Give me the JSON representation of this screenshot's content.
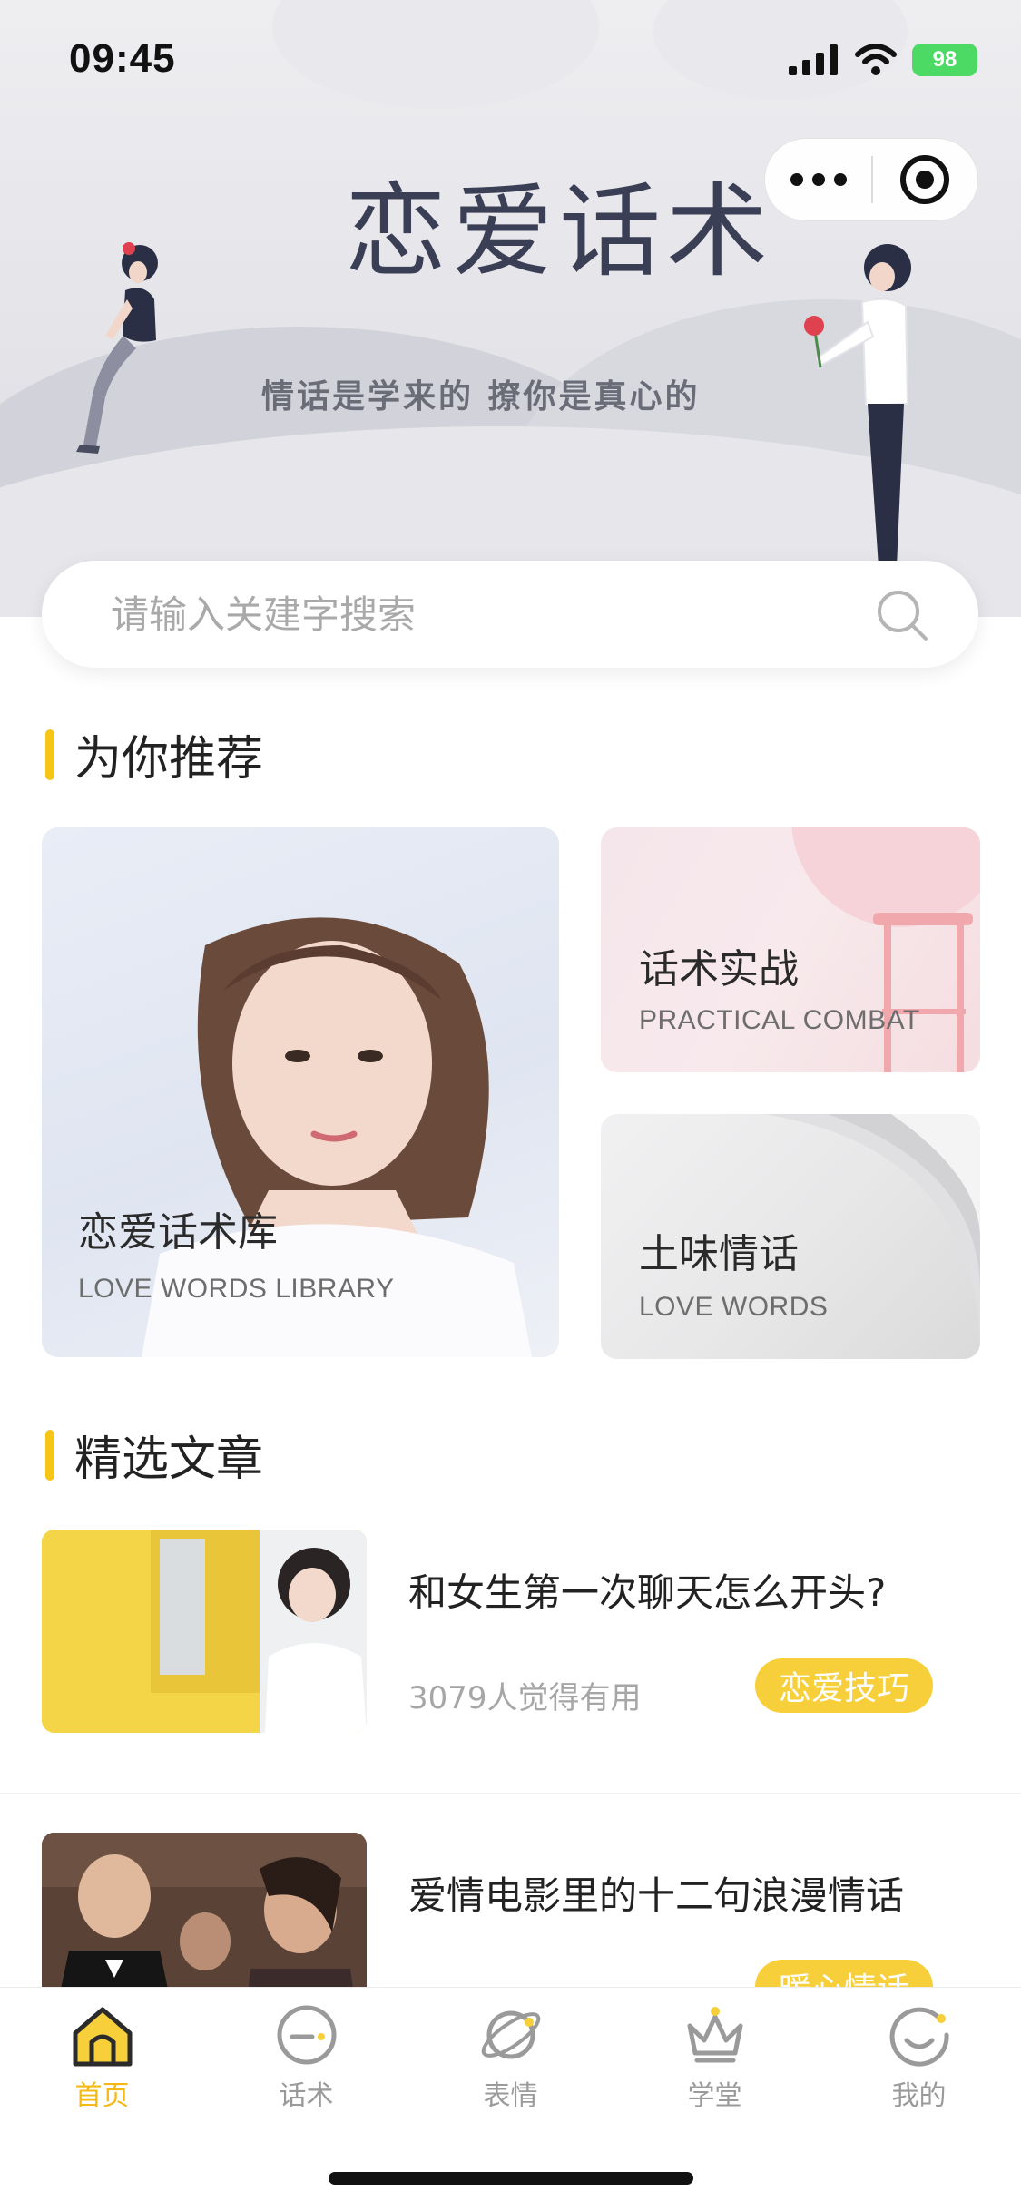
{
  "status_bar": {
    "time": "09:45",
    "battery": "98"
  },
  "hero": {
    "title": "恋爱话术",
    "subtitle": "情话是学来的 撩你是真心的"
  },
  "capsule": {
    "more_icon": "ellipsis-icon",
    "target_icon": "target-icon"
  },
  "search": {
    "placeholder": "请输入关建字搜索",
    "icon": "search-icon"
  },
  "recommend": {
    "title": "为你推荐",
    "cards": [
      {
        "title": "恋爱话术库",
        "subtitle": "LOVE WORDS LIBRARY"
      },
      {
        "title": "话术实战",
        "subtitle": "PRACTICAL COMBAT"
      },
      {
        "title": "土味情话",
        "subtitle": "LOVE WORDS"
      }
    ]
  },
  "articles": {
    "title": "精选文章",
    "items": [
      {
        "title": "和女生第一次聊天怎么开头?",
        "meta": "3079人觉得有用",
        "tag": "恋爱技巧"
      },
      {
        "title": "爱情电影里的十二句浪漫情话",
        "meta": "",
        "tag": "暖心情话"
      }
    ]
  },
  "tabbar": {
    "items": [
      {
        "label": "首页",
        "icon": "home-icon",
        "active": true
      },
      {
        "label": "话术",
        "icon": "chat-bubble-icon",
        "active": false
      },
      {
        "label": "表情",
        "icon": "planet-icon",
        "active": false
      },
      {
        "label": "学堂",
        "icon": "crown-icon",
        "active": false
      },
      {
        "label": "我的",
        "icon": "smile-icon",
        "active": false
      }
    ]
  },
  "colors": {
    "accent": "#f5c518",
    "tag": "#f7cf3a",
    "active_tab": "#f5b915"
  }
}
